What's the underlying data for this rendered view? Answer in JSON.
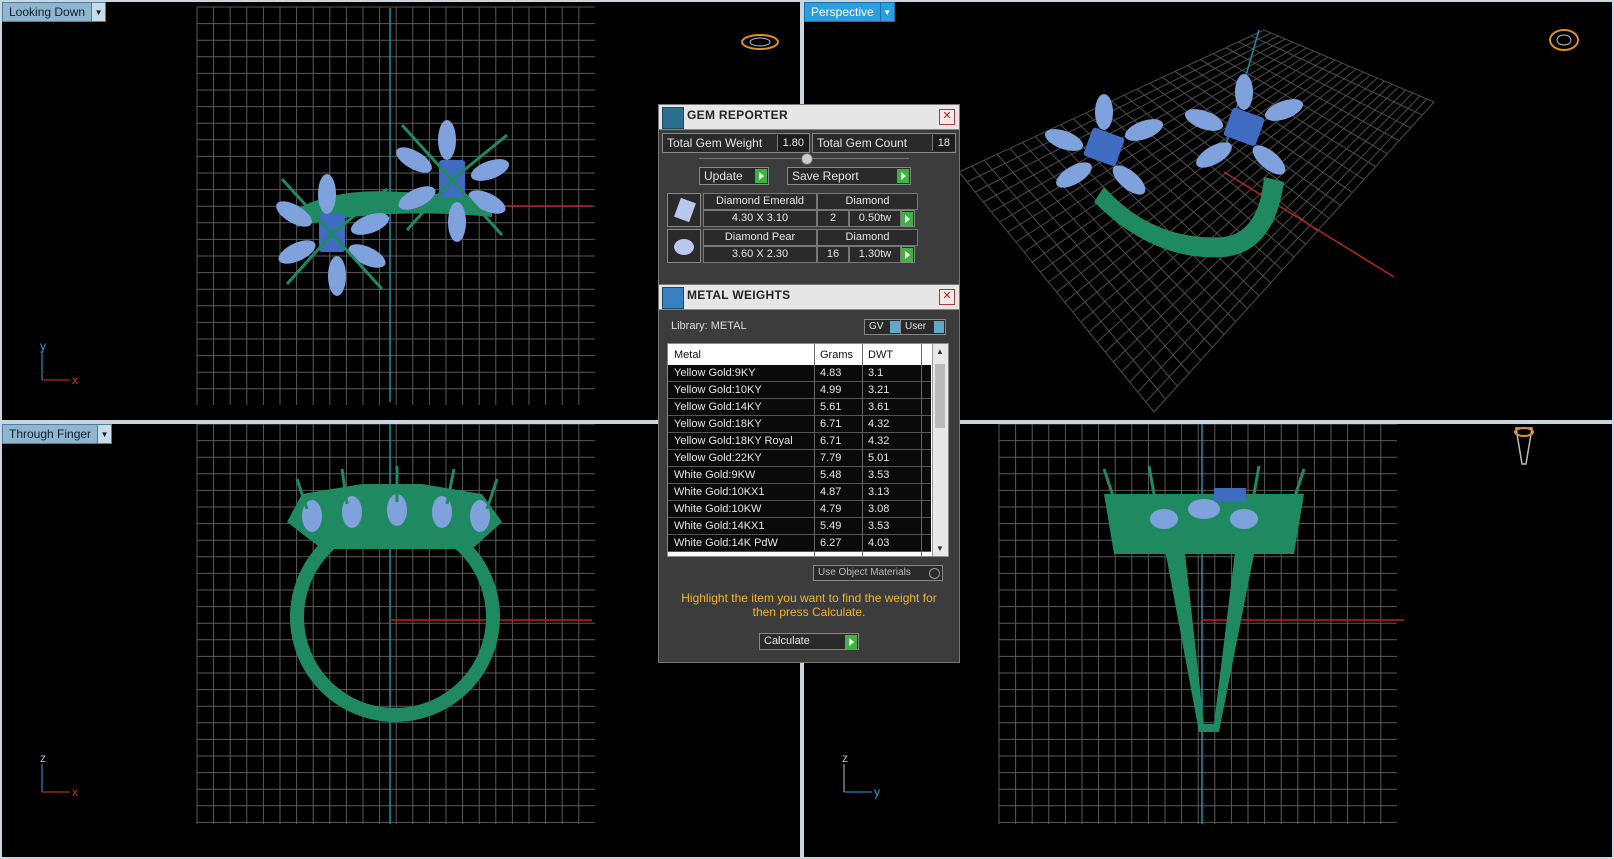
{
  "viewports": {
    "top_left": {
      "label": "Looking Down",
      "axis_v": "y",
      "axis_h": "x"
    },
    "top_right": {
      "label": "Perspective"
    },
    "bottom_left": {
      "label": "Through Finger",
      "axis_v": "z",
      "axis_h": "x"
    },
    "bottom_right": {
      "axis_v": "z",
      "axis_h": "y"
    }
  },
  "gem_reporter": {
    "title": "GEM REPORTER",
    "total_weight_label": "Total Gem Weight",
    "total_weight_value": "1.80",
    "total_count_label": "Total Gem Count",
    "total_count_value": "18",
    "update_label": "Update",
    "save_label": "Save Report",
    "gems": [
      {
        "name": "Diamond Emerald",
        "material": "Diamond",
        "size": "4.30 X 3.10",
        "count": "2",
        "weight": "0.50tw"
      },
      {
        "name": "Diamond Pear",
        "material": "Diamond",
        "size": "3.60 X 2.30",
        "count": "16",
        "weight": "1.30tw"
      }
    ]
  },
  "metal_weights": {
    "title": "METAL WEIGHTS",
    "library_label": "Library: METAL",
    "gv_label": "GV",
    "user_label": "User",
    "columns": [
      "Metal",
      "Grams",
      "DWT"
    ],
    "rows": [
      [
        "Yellow Gold:9KY",
        "4.83",
        "3.1"
      ],
      [
        "Yellow Gold:10KY",
        "4.99",
        "3.21"
      ],
      [
        "Yellow Gold:14KY",
        "5.61",
        "3.61"
      ],
      [
        "Yellow Gold:18KY",
        "6.71",
        "4.32"
      ],
      [
        "Yellow Gold:18KY Royal",
        "6.71",
        "4.32"
      ],
      [
        "Yellow Gold:22KY",
        "7.79",
        "5.01"
      ],
      [
        "White Gold:9KW",
        "5.48",
        "3.53"
      ],
      [
        "White Gold:10KX1",
        "4.87",
        "3.13"
      ],
      [
        "White Gold:10KW",
        "4.79",
        "3.08"
      ],
      [
        "White Gold:14KX1",
        "5.49",
        "3.53"
      ],
      [
        "White Gold:14K PdW",
        "6.27",
        "4.03"
      ]
    ],
    "use_object_materials": "Use Object Materials",
    "hint": "Highlight the item you want to find the weight for then press Calculate.",
    "calculate_label": "Calculate"
  },
  "colors": {
    "accent": "#2a9fe0",
    "hint": "#f2b424",
    "ring": "#1f8a62",
    "gem": "#5b84c9"
  }
}
